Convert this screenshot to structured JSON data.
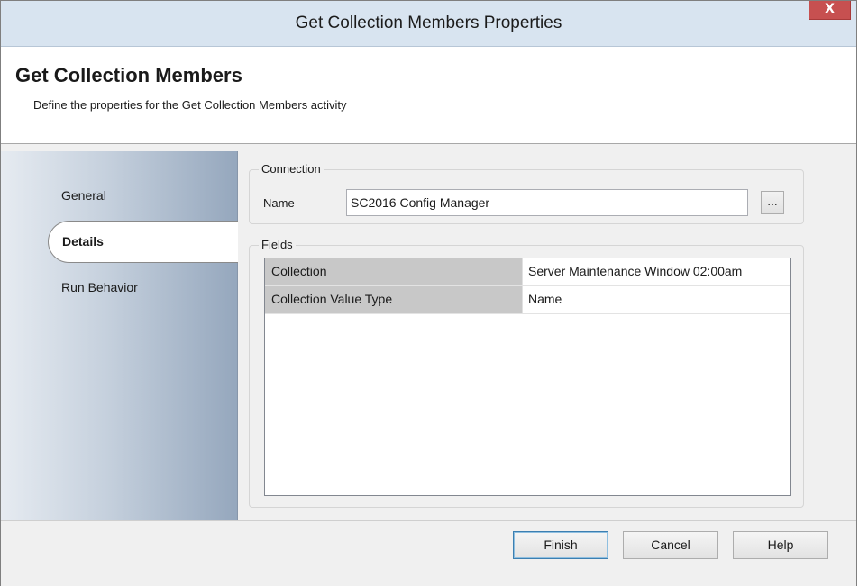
{
  "window": {
    "title": "Get Collection Members Properties",
    "close_label": "X"
  },
  "header": {
    "title": "Get Collection Members",
    "subtitle": "Define the properties for the Get Collection Members activity"
  },
  "sidebar": {
    "items": [
      {
        "label": "General",
        "active": false
      },
      {
        "label": "Details",
        "active": true
      },
      {
        "label": "Run Behavior",
        "active": false
      }
    ]
  },
  "connection": {
    "group_label": "Connection",
    "name_label": "Name",
    "name_value": "SC2016 Config Manager",
    "browse_label": "..."
  },
  "fields": {
    "group_label": "Fields",
    "rows": [
      {
        "key": "Collection",
        "value": "Server Maintenance Window 02:00am"
      },
      {
        "key": "Collection Value Type",
        "value": "Name"
      }
    ]
  },
  "footer": {
    "finish_label": "Finish",
    "cancel_label": "Cancel",
    "help_label": "Help"
  }
}
